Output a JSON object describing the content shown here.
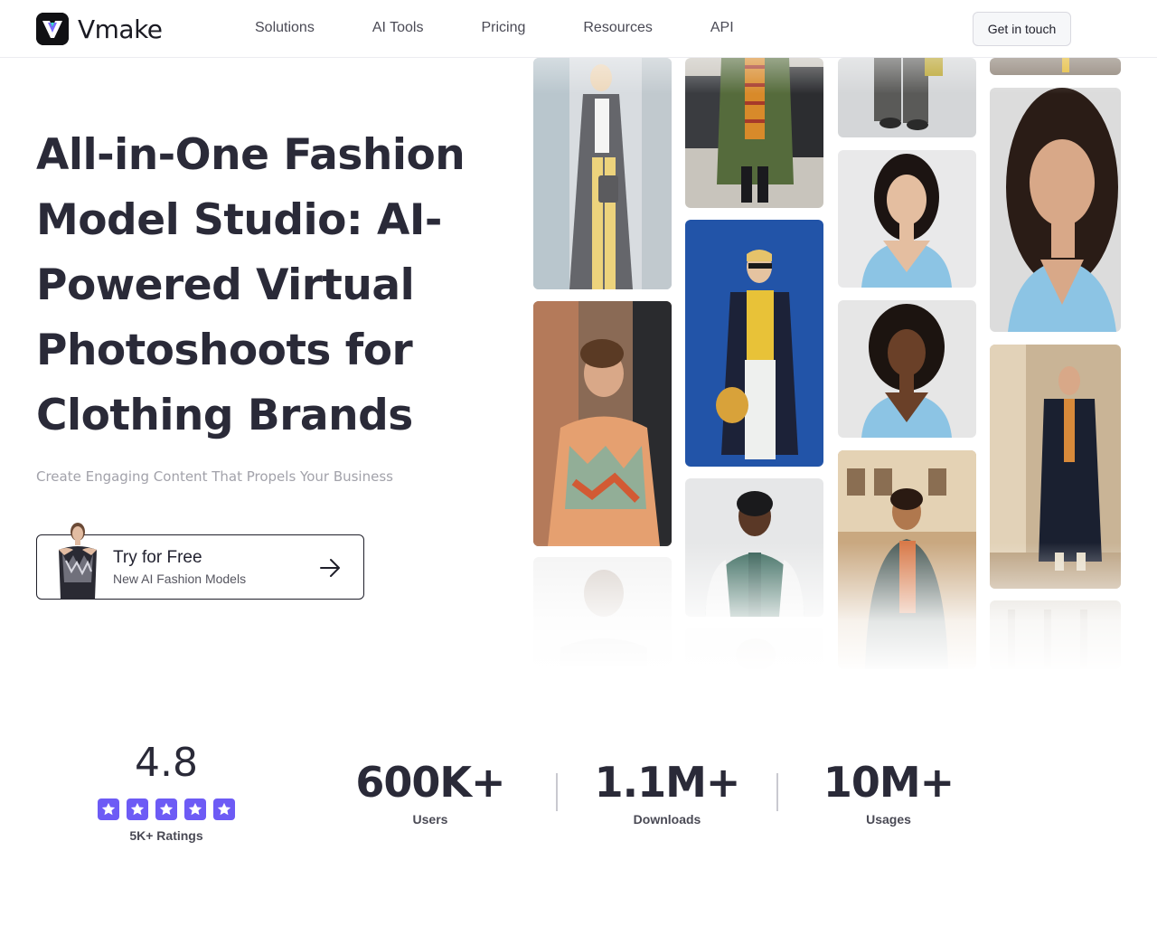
{
  "header": {
    "brand": "Vmake",
    "nav": [
      "Solutions",
      "AI Tools",
      "Pricing",
      "Resources",
      "API"
    ],
    "cta": "Get in touch"
  },
  "hero": {
    "title": "All-in-One Fashion Model Studio: AI-Powered Virtual Photoshoots for Clothing Brands",
    "subtitle": "Create Engaging Content That Propels Your Business",
    "button_title": "Try for Free",
    "button_subtitle": "New AI Fashion Models"
  },
  "stats": {
    "rating": "4.8",
    "rating_label": "5K+ Ratings",
    "stars": 5,
    "users_value": "600K+",
    "users_label": "Users",
    "downloads_value": "1.1M+",
    "downloads_label": "Downloads",
    "usages_value": "10M+",
    "usages_label": "Usages"
  },
  "colors": {
    "accent": "#6d5bf5",
    "text": "#2a2a38",
    "muted": "#a2a2aa"
  }
}
